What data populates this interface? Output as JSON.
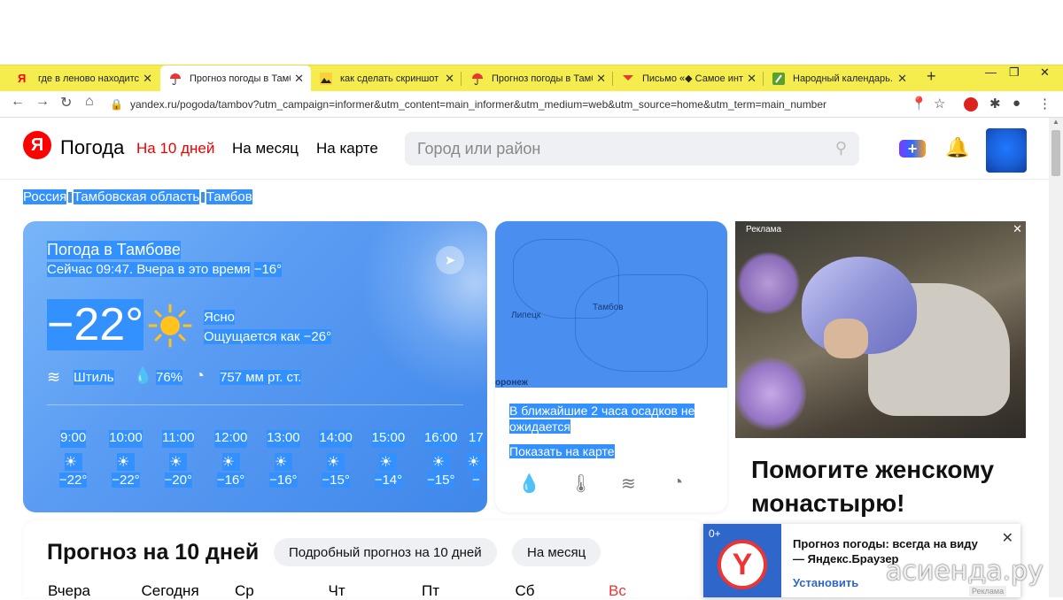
{
  "browser": {
    "tabs": [
      {
        "label": "где в леново находится",
        "icon": "yandex-icon"
      },
      {
        "label": "Прогноз погоды в Тамб",
        "icon": "umbrella-icon",
        "active": true
      },
      {
        "label": "как сделать скриншот н",
        "icon": "mountain-icon"
      },
      {
        "label": "Прогноз погоды в Тамб",
        "icon": "umbrella-icon"
      },
      {
        "label": "Письмо «◆ Самое инте",
        "icon": "mail-icon"
      },
      {
        "label": "Народный календарь. Д",
        "icon": "leaf-icon"
      }
    ],
    "new_tab": "+",
    "url": "yandex.ru/pogoda/tambov?utm_campaign=informer&utm_content=main_informer&utm_medium=web&utm_source=home&utm_term=main_number"
  },
  "header": {
    "logo": "Я",
    "service": "Погода",
    "nav": [
      "На 10 дней",
      "На месяц",
      "На карте"
    ],
    "search_placeholder": "Город или район",
    "plus": "+"
  },
  "breadcrumbs": [
    "Россия",
    "Тамбовская область",
    "Тамбов"
  ],
  "current": {
    "title": "Погода в Тамбове",
    "subtitle": "Сейчас 09:47. Вчера в это время",
    "yesterday_temp": "−16°",
    "temp": "−22°",
    "condition": "Ясно",
    "feels_like": "Ощущается как −26°",
    "wind": "Штиль",
    "humidity": "76%",
    "pressure": "757 мм рт. ст.",
    "hourly": [
      {
        "time": "9:00",
        "temp": "−22°"
      },
      {
        "time": "10:00",
        "temp": "−22°"
      },
      {
        "time": "11:00",
        "temp": "−20°"
      },
      {
        "time": "12:00",
        "temp": "−16°"
      },
      {
        "time": "13:00",
        "temp": "−16°"
      },
      {
        "time": "14:00",
        "temp": "−15°"
      },
      {
        "time": "15:00",
        "temp": "−14°"
      },
      {
        "time": "16:00",
        "temp": "−15°"
      },
      {
        "time": "17",
        "temp": "−"
      }
    ]
  },
  "map_card": {
    "cities": [
      "Липецк",
      "Тамбов",
      "оронеж"
    ],
    "precip_text": "В ближайшие 2 часа осадков не ожидается",
    "show_on_map": "Показать на карте"
  },
  "ad": {
    "label": "Реклама",
    "title": "Помогите женскому монастырю!"
  },
  "forecast": {
    "title": "Прогноз на 10 дней",
    "btn_detailed": "Подробный прогноз на 10 дней",
    "btn_month": "На месяц",
    "days": [
      "Вчера",
      "Сегодня",
      "Ср",
      "Чт",
      "Пт",
      "Сб",
      "Вс"
    ]
  },
  "popup": {
    "badge": "0+",
    "logo": "Y",
    "text": "Прогноз погоды: всегда на виду — Яндекс.Браузер",
    "install": "Установить",
    "ad_label": "Реклама"
  },
  "watermark": "асиенда.ру",
  "colors": {
    "accent_red": "#f00",
    "tab_bar": "#f4ed4d",
    "selection": "#3390ff",
    "card_blue": "#5a9cf3"
  }
}
